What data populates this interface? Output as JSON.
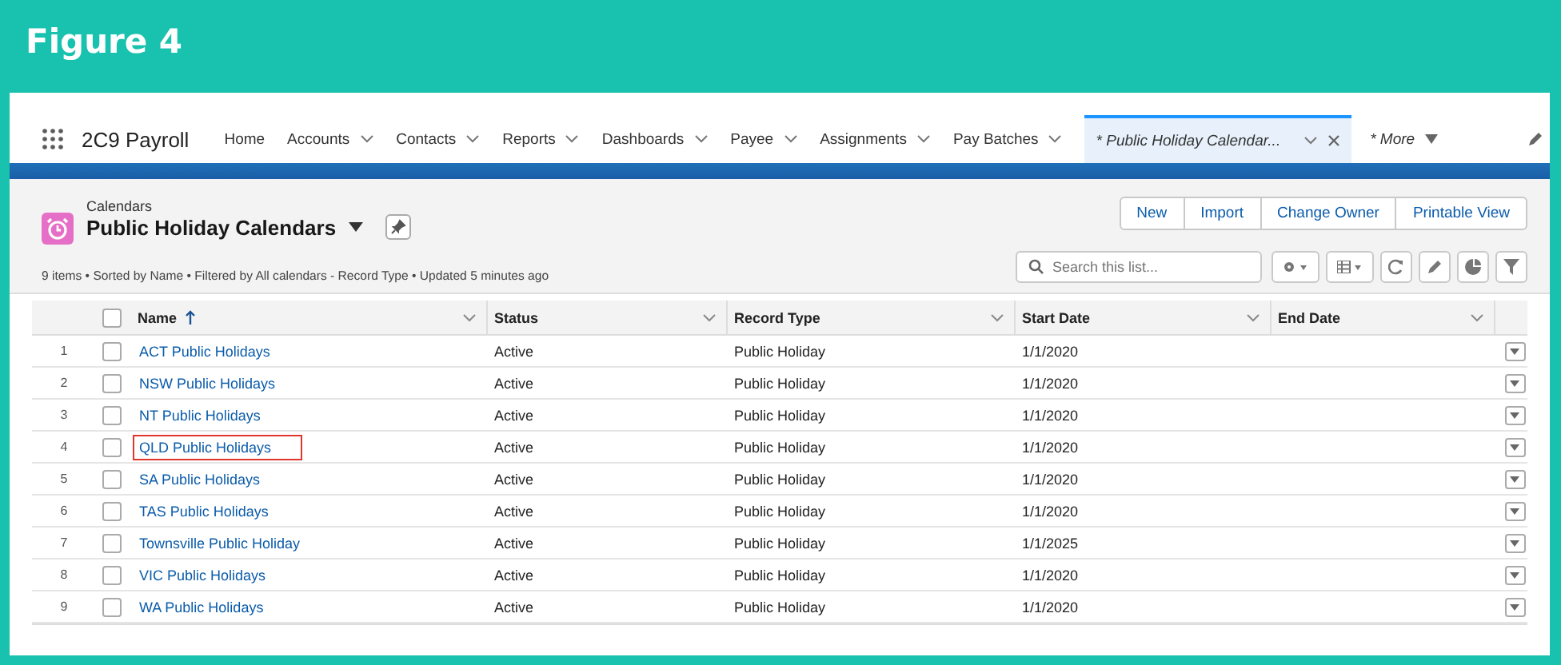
{
  "figure": {
    "title": "Figure 4"
  },
  "app": {
    "name": "2C9 Payroll"
  },
  "nav": [
    {
      "label": "Home",
      "kind": "plain",
      "selected": false
    },
    {
      "label": "Accounts",
      "kind": "menu",
      "selected": false
    },
    {
      "label": "Contacts",
      "kind": "menu",
      "selected": false
    },
    {
      "label": "Reports",
      "kind": "menu",
      "selected": false
    },
    {
      "label": "Dashboards",
      "kind": "menu",
      "selected": false
    },
    {
      "label": "Payee",
      "kind": "menu",
      "selected": false
    },
    {
      "label": "Assignments",
      "kind": "menu",
      "selected": false
    },
    {
      "label": "Pay Batches",
      "kind": "menu",
      "selected": false
    },
    {
      "label": "* Public Holiday Calendar...",
      "kind": "tab",
      "selected": true
    },
    {
      "label": "* More",
      "kind": "more",
      "selected": false
    }
  ],
  "list": {
    "object": "Calendars",
    "title": "Public Holiday Calendars",
    "summary": "9 items • Sorted by Name • Filtered by All calendars - Record Type • Updated 5 minutes ago"
  },
  "buttons": [
    "New",
    "Import",
    "Change Owner",
    "Printable View"
  ],
  "search": {
    "placeholder": "Search this list..."
  },
  "table": {
    "select_all_checked": false,
    "columns": [
      {
        "label": "Name",
        "sorted": true
      },
      {
        "label": "Status",
        "sorted": false
      },
      {
        "label": "Record Type",
        "sorted": false
      },
      {
        "label": "Start Date",
        "sorted": false
      },
      {
        "label": "End Date",
        "sorted": false
      }
    ],
    "rows": [
      {
        "num": "1",
        "name": "ACT Public Holidays",
        "status": "Active",
        "record_type": "Public Holiday",
        "start_date": "1/1/2020",
        "checked": false,
        "highlighted": false
      },
      {
        "num": "2",
        "name": "NSW Public Holidays",
        "status": "Active",
        "record_type": "Public Holiday",
        "start_date": "1/1/2020",
        "checked": false,
        "highlighted": false
      },
      {
        "num": "3",
        "name": "NT Public Holidays",
        "status": "Active",
        "record_type": "Public Holiday",
        "start_date": "1/1/2020",
        "checked": false,
        "highlighted": false
      },
      {
        "num": "4",
        "name": "QLD Public Holidays",
        "status": "Active",
        "record_type": "Public Holiday",
        "start_date": "1/1/2020",
        "checked": false,
        "highlighted": true
      },
      {
        "num": "5",
        "name": "SA Public Holidays",
        "status": "Active",
        "record_type": "Public Holiday",
        "start_date": "1/1/2020",
        "checked": false,
        "highlighted": false
      },
      {
        "num": "6",
        "name": "TAS Public Holidays",
        "status": "Active",
        "record_type": "Public Holiday",
        "start_date": "1/1/2020",
        "checked": false,
        "highlighted": false
      },
      {
        "num": "7",
        "name": "Townsville Public Holiday",
        "status": "Active",
        "record_type": "Public Holiday",
        "start_date": "1/1/2025",
        "checked": false,
        "highlighted": false
      },
      {
        "num": "8",
        "name": "VIC Public Holidays",
        "status": "Active",
        "record_type": "Public Holiday",
        "start_date": "1/1/2020",
        "checked": false,
        "highlighted": false
      },
      {
        "num": "9",
        "name": "WA Public Holidays",
        "status": "Active",
        "record_type": "Public Holiday",
        "start_date": "1/1/2020",
        "checked": false,
        "highlighted": false
      }
    ]
  }
}
